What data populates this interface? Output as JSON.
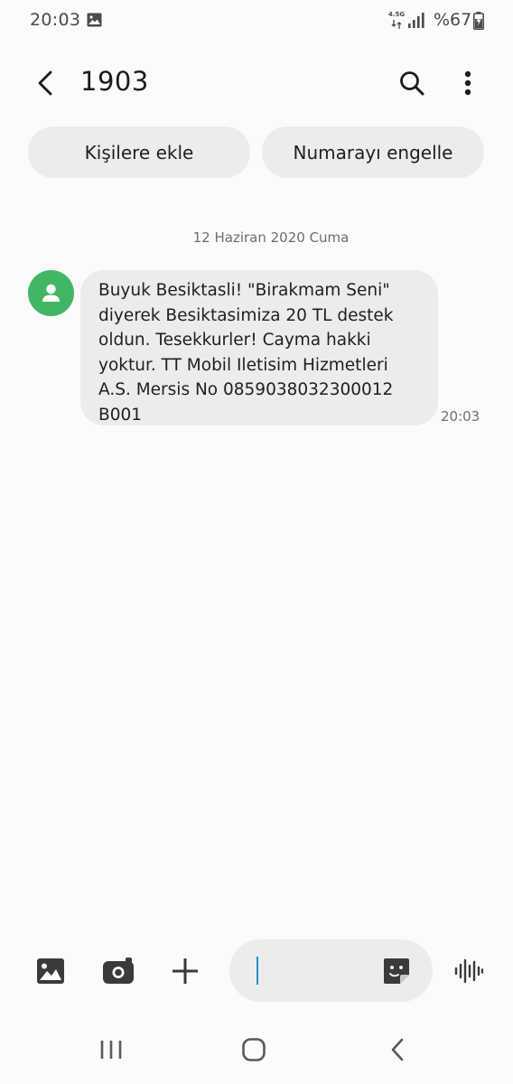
{
  "status_bar": {
    "time": "20:03",
    "network_type": "4.5G",
    "battery_text": "%67",
    "icons": [
      "gallery-icon",
      "network-icon",
      "signal-icon",
      "battery-charging-icon"
    ]
  },
  "app_bar": {
    "title": "1903",
    "icons": [
      "back-arrow-icon",
      "search-icon",
      "more-vertical-icon"
    ]
  },
  "actions": {
    "add_contact": "Kişilere ekle",
    "block_number": "Numarayı engelle"
  },
  "conversation": {
    "date": "12 Haziran 2020 Cuma",
    "messages": [
      {
        "text": "Buyuk Besiktasli! \"Birakmam Seni\"\ndiyerek Besiktasimiza 20 TL destek\noldun. Tesekkurler! Cayma hakki\nyoktur. TT Mobil Iletisim Hizmetleri\nA.S. Mersis No 0859038032300012\nB001",
        "time": "20:03"
      }
    ]
  },
  "composer": {
    "icons": [
      "image-icon",
      "camera-icon",
      "plus-icon",
      "sticker-icon",
      "voice-wave-icon"
    ]
  },
  "nav_bar": {
    "icons": [
      "recents-icon",
      "home-icon",
      "back-icon"
    ]
  },
  "colors": {
    "background": "#fbfbfb",
    "bubble": "#ececec",
    "avatar": "#41b765",
    "caret": "#1b8fd0"
  }
}
